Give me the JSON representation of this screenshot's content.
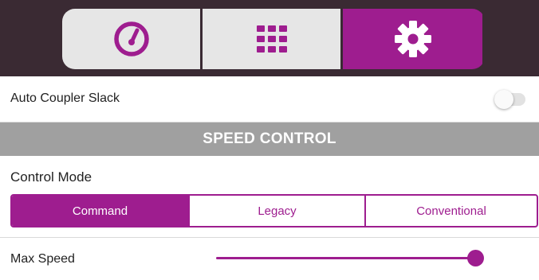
{
  "tabs": [
    {
      "icon": "speedometer-icon",
      "active": false
    },
    {
      "icon": "grid-icon",
      "active": false
    },
    {
      "icon": "gear-icon",
      "active": true
    }
  ],
  "settings": {
    "auto_coupler_slack": {
      "label": "Auto Coupler Slack",
      "enabled": false
    }
  },
  "speed_control": {
    "header": "SPEED CONTROL",
    "control_mode": {
      "label": "Control Mode",
      "options": [
        "Command",
        "Legacy",
        "Conventional"
      ],
      "selected": "Command"
    },
    "max_speed": {
      "label": "Max Speed",
      "value_fraction": 0.97
    }
  },
  "colors": {
    "accent": "#9e1d8f",
    "topbar": "#3a2a33",
    "tab_inactive": "#e6e6e6",
    "section_header": "#a0a0a0"
  }
}
